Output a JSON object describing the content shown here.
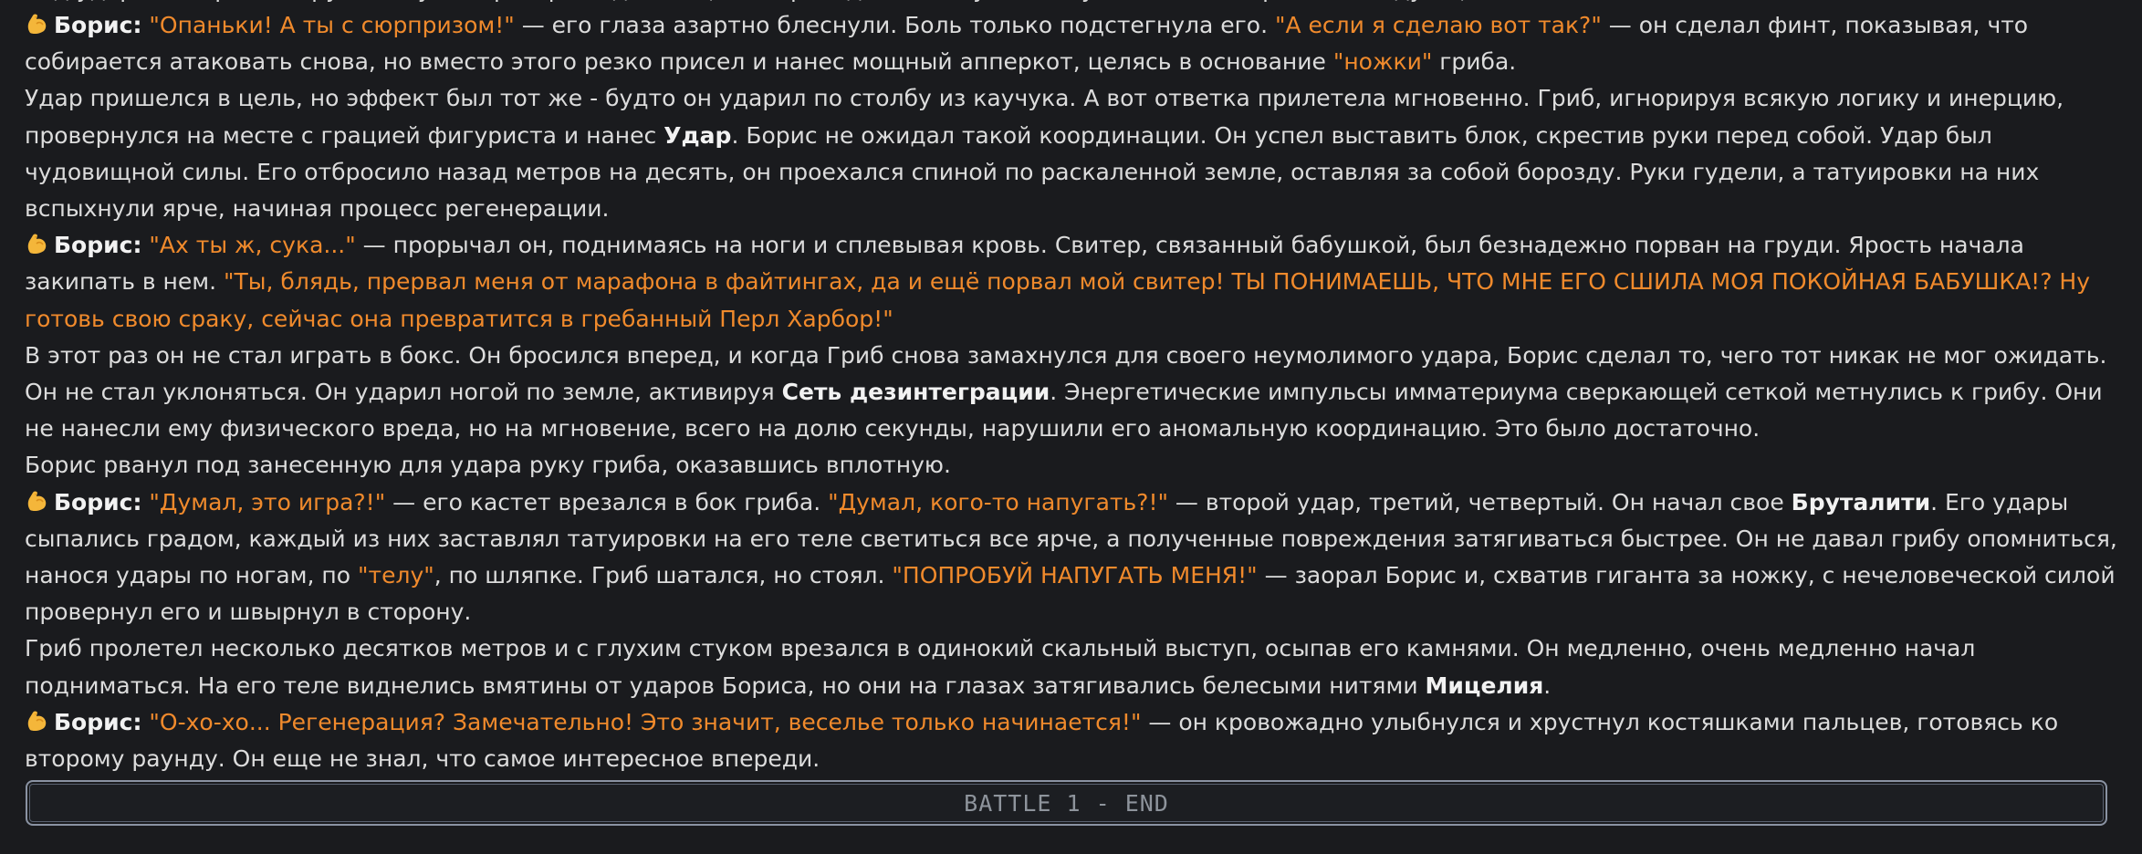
{
  "story": {
    "cutoff_line": "под удар его огромной руки, и тут же разорвал дистанцию, переходя в боковую стойку, готовясь встретить следующий натиск.",
    "p1": {
      "speaker": "Борис:",
      "q1": "\"Опаньки! А ты с сюрпризом!\"",
      "t1": " — его глаза азартно блеснули. Боль только подстегнула его. ",
      "q2": "\"А если я сделаю вот так?\"",
      "t2": " — он сделал финт, показывая, что собирается атаковать снова, но вместо этого резко присел и нанес мощный апперкот, целясь в основание ",
      "q3": "\"ножки\"",
      "t3": " гриба."
    },
    "p2": {
      "t1": "Удар пришелся в цель, но эффект был тот же - будто он ударил по столбу из каучука. А вот ответка прилетела мгновенно. Гриб, игнорируя всякую логику и инерцию, провернулся на месте с грацией фигуриста и нанес ",
      "b1": "Удар",
      "t2": ". Борис не ожидал такой координации. Он успел выставить блок, скрестив руки перед собой. Удар был чудовищной силы. Его отбросило назад метров на десять, он проехался спиной по раскаленной земле, оставляя за собой борозду. Руки гудели, а татуировки на них вспыхнули ярче, начиная процесс регенерации."
    },
    "p3": {
      "speaker": "Борис:",
      "q1": "\"Ах ты ж, сука...\"",
      "t1": " — прорычал он, поднимаясь на ноги и сплевывая кровь. Свитер, связанный бабушкой, был безнадежно порван на груди. Ярость начала закипать в нем. ",
      "q2": "\"Ты, блядь, прервал меня от марафона в файтингах, да и ещё порвал мой свитер! ТЫ ПОНИМАЕШЬ, ЧТО МНЕ ЕГО СШИЛА МОЯ ПОКОЙНАЯ БАБУШКА!? Ну готовь свою сраку, сейчас она превратится в гребанный Перл Харбор!\""
    },
    "p4": {
      "t1": "В этот раз он не стал играть в бокс. Он бросился вперед, и когда Гриб снова замахнулся для своего неумолимого удара, Борис сделал то, чего тот никак не мог ожидать. Он не стал уклоняться. Он ударил ногой по земле, активируя ",
      "b1": "Сеть дезинтеграции",
      "t2": ". Энергетические импульсы имматериума сверкающей сеткой метнулись к грибу. Они не нанесли ему физического вреда, но на мгновение, всего на долю секунды, нарушили его аномальную координацию. Это было достаточно."
    },
    "p5": {
      "t1": "Борис рванул под занесенную для удара руку гриба, оказавшись вплотную."
    },
    "p6": {
      "speaker": "Борис:",
      "q1": "\"Думал, это игра?!\"",
      "t1": " — его кастет врезался в бок гриба. ",
      "q2": "\"Думал, кого-то напугать?!\"",
      "t2": " — второй удар, третий, четвертый. Он начал свое ",
      "b1": "Бруталити",
      "t3": ". Его удары сыпались градом, каждый из них заставлял татуировки на его теле светиться все ярче, а полученные повреждения затягиваться быстрее. Он не давал грибу опомниться, нанося удары по ногам, по ",
      "q3": "\"телу\"",
      "t4": ", по шляпке. Гриб шатался, но стоял. ",
      "q4": "\"ПОПРОБУЙ НАПУГАТЬ МЕНЯ!\"",
      "t5": " — заорал Борис и, схватив гиганта за ножку, с нечеловеческой силой провернул его и швырнул в сторону."
    },
    "p7": {
      "t1": "Гриб пролетел несколько десятков метров и с глухим стуком врезался в одинокий скальный выступ, осыпав его камнями. Он медленно, очень медленно начал подниматься. На его теле виднелись вмятины от ударов Бориса, но они на глазах затягивались белесыми нитями ",
      "b1": "Мицелия",
      "t2": "."
    },
    "p8": {
      "speaker": "Борис:",
      "q1": "\"О-хо-хо... Регенерация? Замечательно! Это значит, веселье только начинается!\"",
      "t1": " — он кровожадно улыбнулся и хрустнул костяшками пальцев, готовясь ко второму раунду. Он еще не знал, что самое интересное впереди."
    }
  },
  "battle_marker": {
    "label": "BATTLE 1 - END"
  },
  "icons": {
    "speaker_icon": "flexed-biceps-icon"
  },
  "colors": {
    "background": "#1a1b1e",
    "text": "#dcdcdc",
    "quote": "#f08a2c",
    "bold": "#f2f2f2",
    "marker_border": "#8a93a3",
    "marker_text": "#8e949c"
  }
}
